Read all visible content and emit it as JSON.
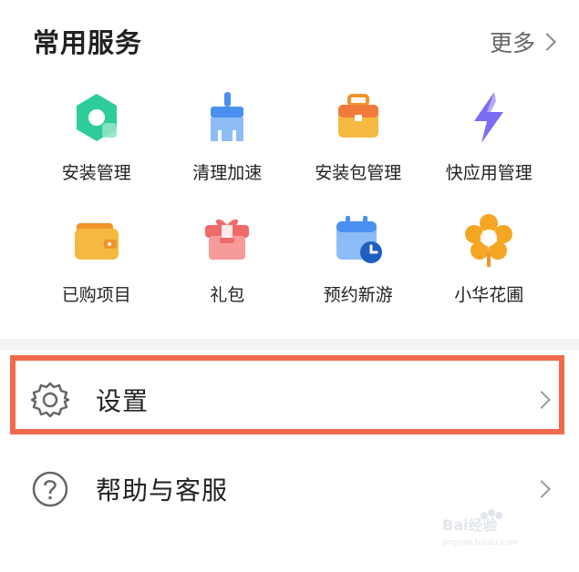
{
  "section": {
    "title": "常用服务",
    "more_label": "更多"
  },
  "services": [
    {
      "label": "安装管理",
      "icon": "hexagon-install-icon",
      "color": "#2ecc9a"
    },
    {
      "label": "清理加速",
      "icon": "broom-clean-icon",
      "color": "#4a90f0"
    },
    {
      "label": "安装包管理",
      "icon": "briefcase-package-icon",
      "color": "#f5a623"
    },
    {
      "label": "快应用管理",
      "icon": "lightning-icon",
      "color": "#7b6cf6"
    },
    {
      "label": "已购项目",
      "icon": "wallet-icon",
      "color": "#f5b942"
    },
    {
      "label": "礼包",
      "icon": "gift-icon",
      "color": "#f06a6a"
    },
    {
      "label": "预约新游",
      "icon": "calendar-clock-icon",
      "color": "#4a90f0"
    },
    {
      "label": "小华花圃",
      "icon": "flower-icon",
      "color": "#f5a623"
    }
  ],
  "settings": {
    "label": "设置",
    "icon": "gear-icon"
  },
  "help": {
    "label": "帮助与客服",
    "icon": "help-circle-icon"
  },
  "watermark": {
    "logo": "Bai经验",
    "url": "jingyan.baidu.com"
  },
  "accent": "#f26a4b"
}
